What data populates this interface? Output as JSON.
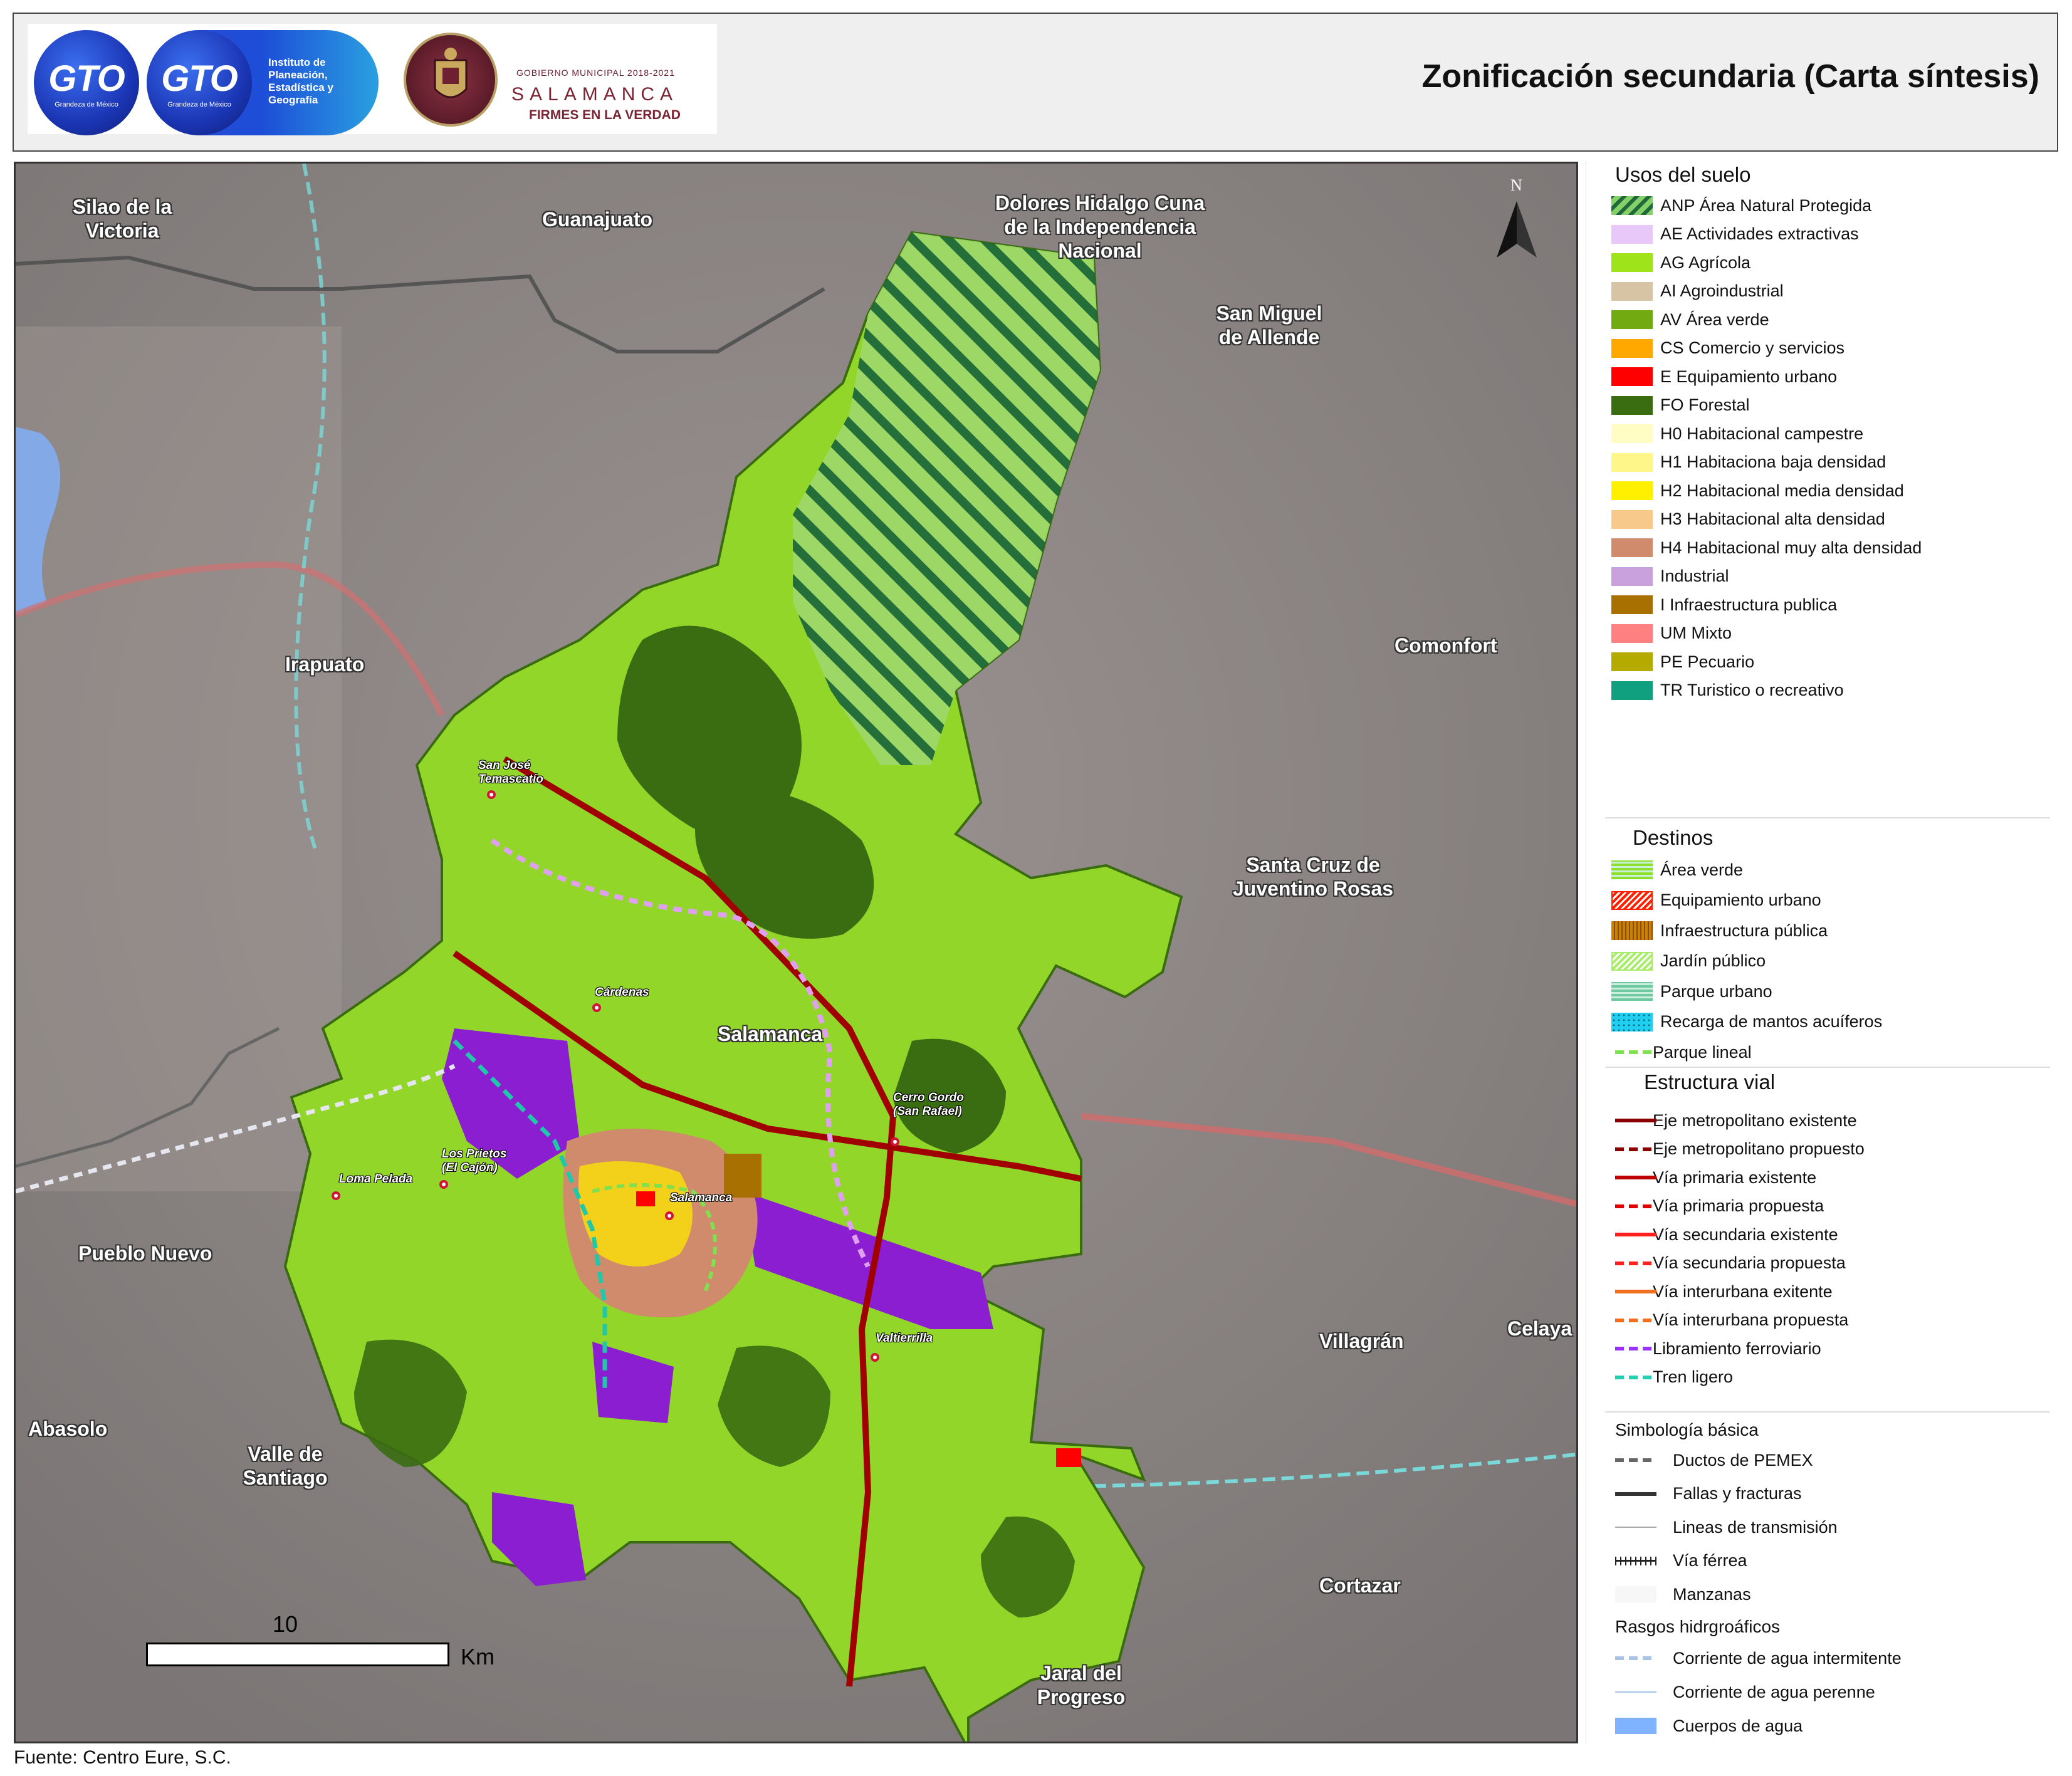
{
  "header": {
    "title": "Zonificación secundaria (Carta síntesis)",
    "logos": {
      "gto_main": "GTO",
      "gto_main_sub": "Grandeza de México",
      "gto_iplaneg": "GTO",
      "gto_iplaneg_sub": "Grandeza de México",
      "iplaneg_text": "Instituto de Planeación, Estadística y Geografía",
      "gobierno_label": "GOBIERNO MUNICIPAL 2018-2021",
      "city_name": "SALAMANCA",
      "motto": "FIRMES EN LA VERDAD"
    }
  },
  "map": {
    "north_label": "N",
    "scale": {
      "value": "10",
      "unit": "Km"
    },
    "places": [
      "Silao de la Victoria",
      "Guanajuato",
      "Dolores Hidalgo Cuna de la Independencia Nacional",
      "San Miguel de Allende",
      "Irapuato",
      "Comonfort",
      "Santa Cruz de Juventino Rosas",
      "Salamanca",
      "Pueblo Nuevo",
      "Villagrán",
      "Celaya",
      "Abasolo",
      "Valle de Santiago",
      "Cortazar",
      "Jaral del Progreso"
    ],
    "localities": [
      "San José Temascatío",
      "Cárdenas",
      "Cerro Gordo (San Rafael)",
      "Los Prietos (El Cajón)",
      "Loma Pelada",
      "Salamanca",
      "Valtierrilla"
    ]
  },
  "legend": {
    "usos": {
      "title": "Usos del suelo",
      "items": [
        {
          "label": "ANP Área Natural Protegida",
          "color": "#86d06a"
        },
        {
          "label": "AE Actividades extractivas",
          "color": "#e8c8f8"
        },
        {
          "label": "AG Agrícola",
          "color": "#9fe31a"
        },
        {
          "label": "AI Agroindustrial",
          "color": "#d6c4a4"
        },
        {
          "label": "AV Área verde",
          "color": "#72aa12"
        },
        {
          "label": "CS Comercio y servicios",
          "color": "#ffa800"
        },
        {
          "label": "E Equipamiento urbano",
          "color": "#ff0000"
        },
        {
          "label": "FO Forestal",
          "color": "#3a6d12"
        },
        {
          "label": "H0 Habitacional campestre",
          "color": "#fffcc4"
        },
        {
          "label": "H1 Habitaciona baja densidad",
          "color": "#fff68a"
        },
        {
          "label": "H2 Habitacional media densidad",
          "color": "#fff000"
        },
        {
          "label": "H3 Habitacional alta densidad",
          "color": "#f7c98a"
        },
        {
          "label": "H4 Habitacional muy alta densidad",
          "color": "#cf8b6c"
        },
        {
          "label": "Industrial",
          "color": "#c7a0dc"
        },
        {
          "label": "I Infraestructura publica",
          "color": "#a87000"
        },
        {
          "label": "UM Mixto",
          "color": "#ff8080"
        },
        {
          "label": "PE Pecuario",
          "color": "#b5aa00"
        },
        {
          "label": "TR Turistico o recreativo",
          "color": "#10a080"
        }
      ]
    },
    "destinos": {
      "title": "Destinos",
      "items": [
        {
          "label": "Área verde",
          "color": "#8ee02a"
        },
        {
          "label": "Equipamiento urbano",
          "color": "#ff2000"
        },
        {
          "label": "Infraestructura pública",
          "color": "#c88200"
        },
        {
          "label": "Jardín público",
          "color": "#a8ec6a"
        },
        {
          "label": "Parque urbano",
          "color": "#6fc8a0"
        },
        {
          "label": "Recarga de mantos acuíferos",
          "color": "#21d0f0"
        },
        {
          "label": "Parque lineal",
          "color": "#7fe050"
        }
      ]
    },
    "vial": {
      "title": "Estructura vial",
      "items": [
        {
          "label": "Eje metropolitano existente",
          "color": "#8b0000",
          "style": "solid"
        },
        {
          "label": "Eje metropolitano propuesto",
          "color": "#8b0000",
          "style": "dashed"
        },
        {
          "label": "Vía primaria existente",
          "color": "#c00000",
          "style": "solid"
        },
        {
          "label": "Vía primaria propuesta",
          "color": "#e00000",
          "style": "dashed"
        },
        {
          "label": "Vía secundaria existente",
          "color": "#ff2020",
          "style": "solid"
        },
        {
          "label": "Vía secundaria propuesta",
          "color": "#ff2020",
          "style": "dashed"
        },
        {
          "label": "Vía interurbana exitente",
          "color": "#f07020",
          "style": "solid"
        },
        {
          "label": "Vía interurbana propuesta",
          "color": "#f07020",
          "style": "dashed"
        },
        {
          "label": "Libramiento ferroviario",
          "color": "#9b30ff",
          "style": "dashed"
        },
        {
          "label": "Tren ligero",
          "color": "#20d0b0",
          "style": "dashed"
        }
      ]
    },
    "simbologia": {
      "title": "Simbología básica",
      "items": [
        {
          "label": "Ductos de PEMEX",
          "color": "#666666",
          "style": "dashed"
        },
        {
          "label": "Fallas y fracturas",
          "color": "#333333",
          "style": "solid"
        },
        {
          "label": "Lineas de transmisión",
          "color": "#aaaaaa",
          "style": "thin"
        },
        {
          "label": "Vía férrea",
          "color": "#222222",
          "style": "rail"
        },
        {
          "label": "Manzanas",
          "color": "#f7f7f7",
          "style": "box"
        }
      ]
    },
    "hidro": {
      "title": "Rasgos hidrgroáficos",
      "items": [
        {
          "label": "Corriente de agua intermitente",
          "color": "#a8c4e4",
          "style": "dashed"
        },
        {
          "label": "Corriente de agua perenne",
          "color": "#a8c4e4",
          "style": "thin"
        },
        {
          "label": "Cuerpos de agua",
          "color": "#7fb2ff",
          "style": "box"
        }
      ]
    }
  },
  "footer": {
    "source": "Fuente: Centro Eure, S.C."
  }
}
